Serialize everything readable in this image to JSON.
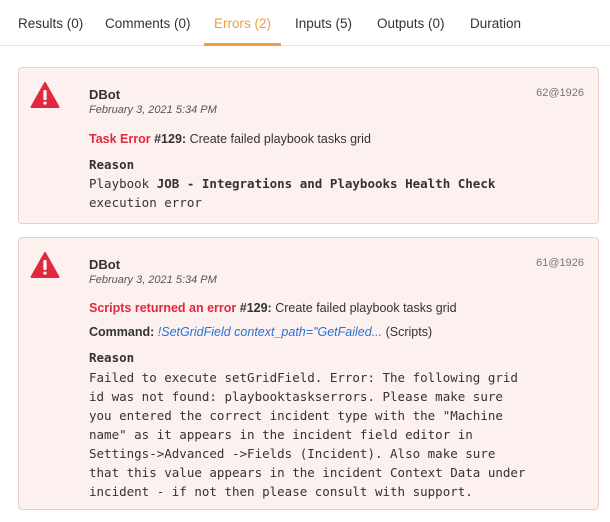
{
  "tabs": [
    {
      "label": "Results (0)"
    },
    {
      "label": "Comments (0)"
    },
    {
      "label": "Errors (2)"
    },
    {
      "label": "Inputs (5)"
    },
    {
      "label": "Outputs (0)"
    },
    {
      "label": "Duration"
    }
  ],
  "active_tab": "Errors (2)",
  "colors": {
    "accent": "#f39c3b",
    "error": "#e1283d",
    "link": "#2a72d5",
    "card_bg": "#fdf1f0",
    "card_border": "#efcaca"
  },
  "errors": [
    {
      "icon": "warning-triangle-icon",
      "author": "DBot",
      "date": "February 3, 2021 5:34 PM",
      "entry_id": "62@1926",
      "error_type": "Task Error",
      "task_number": "#129:",
      "task_name": "Create failed playbook tasks grid",
      "reason_label": "Reason",
      "reason_prefix": "Playbook ",
      "reason_bold": "JOB - Integrations and Playbooks Health Check",
      "reason_suffix": "execution error"
    },
    {
      "icon": "warning-triangle-icon",
      "author": "DBot",
      "date": "February 3, 2021 5:34 PM",
      "entry_id": "61@1926",
      "error_type": "Scripts returned an error",
      "task_number": "#129:",
      "task_name": "Create failed playbook tasks grid",
      "command_label": "Command:",
      "command_value": "!SetGridField context_path=\"GetFailed...",
      "command_source": "(Scripts)",
      "reason_label": "Reason",
      "reason_lines": [
        "Failed to execute setGridField. Error: The following grid",
        "id was not found: playbooktaskserrors. Please make sure",
        "you entered the correct incident type with the \"Machine",
        "name\" as it appears in the incident field editor in",
        "Settings->Advanced ->Fields (Incident). Also make sure",
        "that this value appears in the incident Context Data under",
        "incident - if not then please consult with support."
      ]
    }
  ]
}
